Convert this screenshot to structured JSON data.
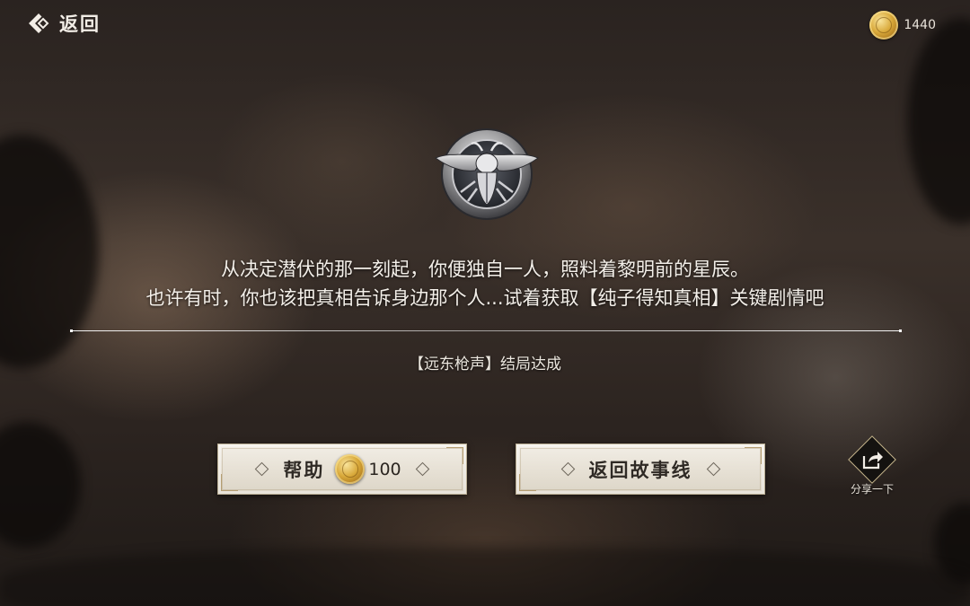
{
  "top_bar": {
    "back_label": "返回",
    "coin_count": "1440"
  },
  "story": {
    "line1": "从决定潜伏的那一刻起，你便独自一人，照料着黎明前的星辰。",
    "line2": "也许有时，你也该把真相告诉身边那个人...试着获取【纯子得知真相】关键剧情吧"
  },
  "ending_status": "【远东枪声】结局达成",
  "buttons": {
    "help_label": "帮助",
    "help_cost": "100",
    "story_label": "返回故事线"
  },
  "share_label": "分享一下",
  "icons": {
    "back": "chevron-left-icon",
    "coin": "gold-coin-icon",
    "medal": "beetle-emblem-icon",
    "share": "share-icon"
  },
  "colors": {
    "text": "#f3efe9",
    "button_bg": "#ece7dd",
    "button_text": "#2f2a25",
    "coin_gold": "#d9a93a",
    "accent_trim": "#b59e72"
  }
}
